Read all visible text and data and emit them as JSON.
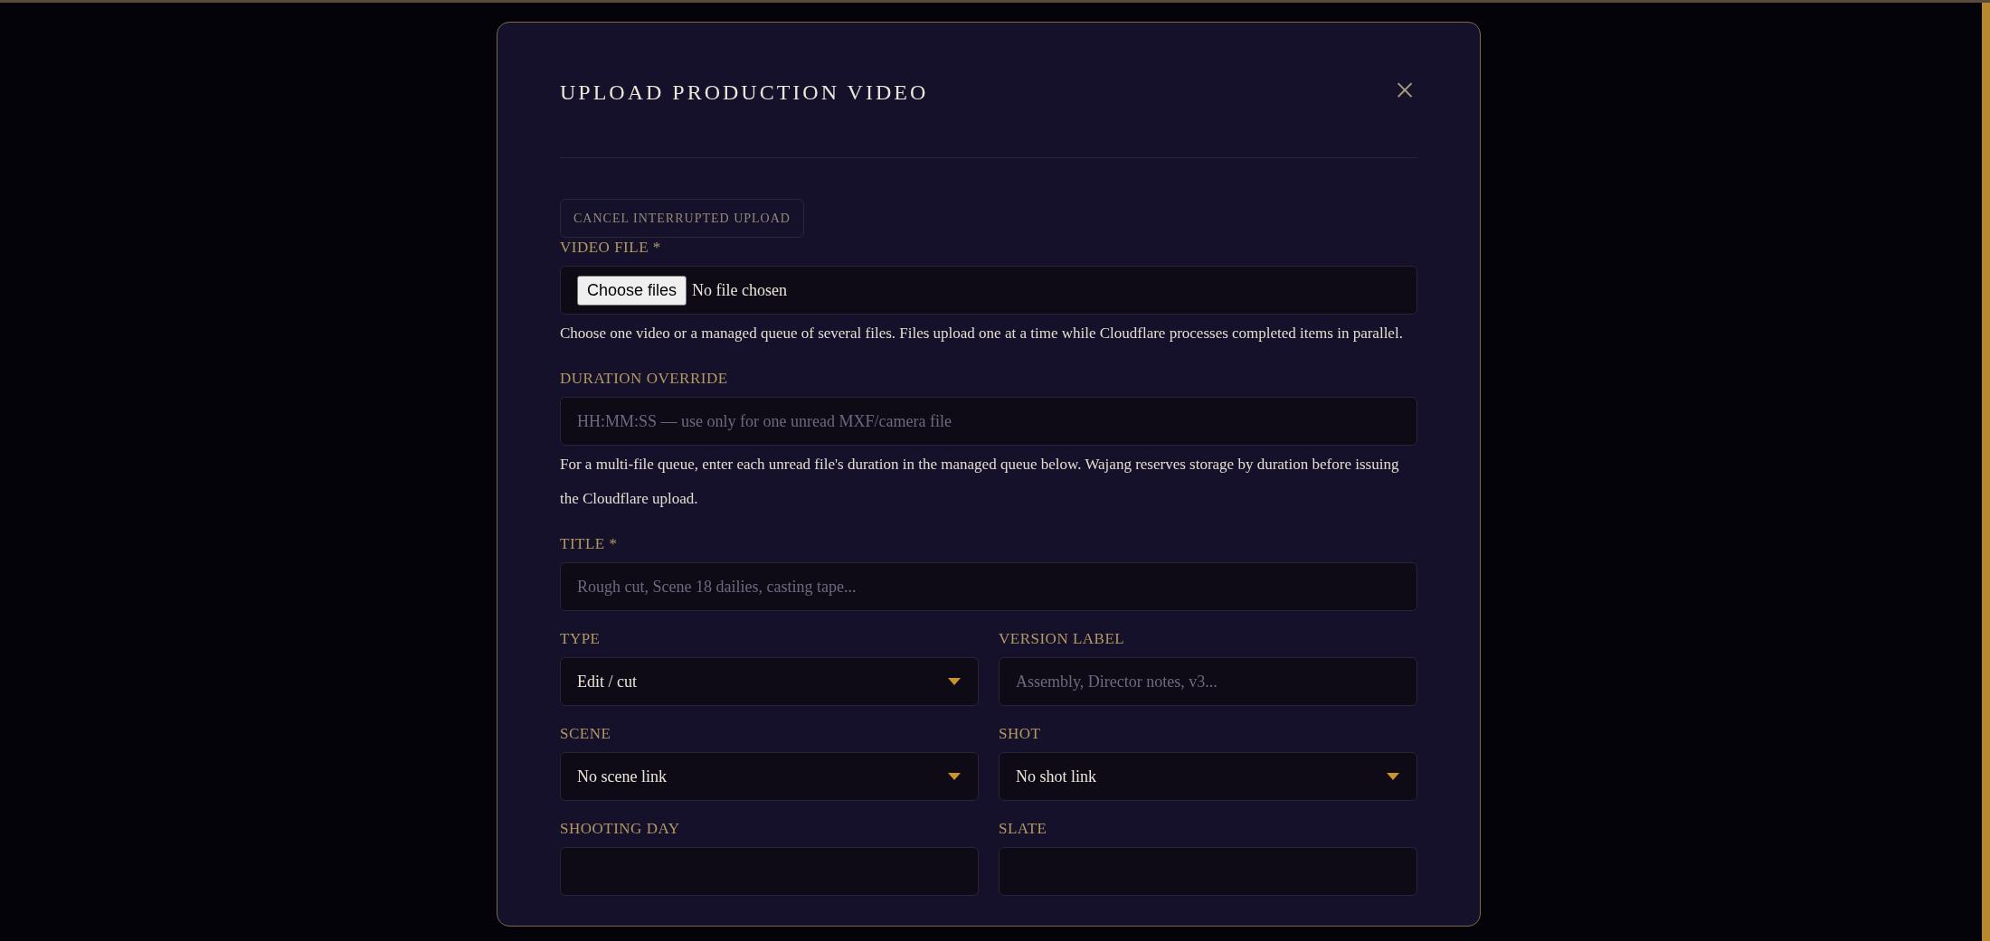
{
  "dialog": {
    "title": "UPLOAD PRODUCTION VIDEO",
    "close": "×",
    "cancel_button": "CANCEL INTERRUPTED UPLOAD",
    "rows": [
      [
        {
          "label": "VIDEO FILE *",
          "kind": "file",
          "button": "Choose files",
          "value": "No file chosen",
          "help": "Choose one video or a managed queue of several files. Files upload one at a time while Cloudflare processes completed items in parallel."
        }
      ],
      [
        {
          "label": "DURATION OVERRIDE",
          "kind": "text",
          "placeholder": "HH:MM:SS — use only for one unread MXF/camera file",
          "help": "For a multi-file queue, enter each unread file's duration in the managed queue below. Wajang reserves storage by duration before issuing the Cloudflare upload."
        }
      ],
      [
        {
          "label": "TITLE *",
          "kind": "text",
          "placeholder": "Rough cut, Scene 18 dailies, casting tape..."
        }
      ],
      [
        {
          "label": "TYPE",
          "kind": "select",
          "value": "Edit / cut"
        },
        {
          "label": "VERSION LABEL",
          "kind": "text",
          "placeholder": "Assembly, Director notes, v3..."
        }
      ],
      [
        {
          "label": "SCENE",
          "kind": "select",
          "value": "No scene link"
        },
        {
          "label": "SHOT",
          "kind": "select",
          "value": "No shot link"
        }
      ],
      [
        {
          "label": "SHOOTING DAY",
          "kind": "text"
        },
        {
          "label": "SLATE",
          "kind": "text"
        }
      ]
    ]
  }
}
